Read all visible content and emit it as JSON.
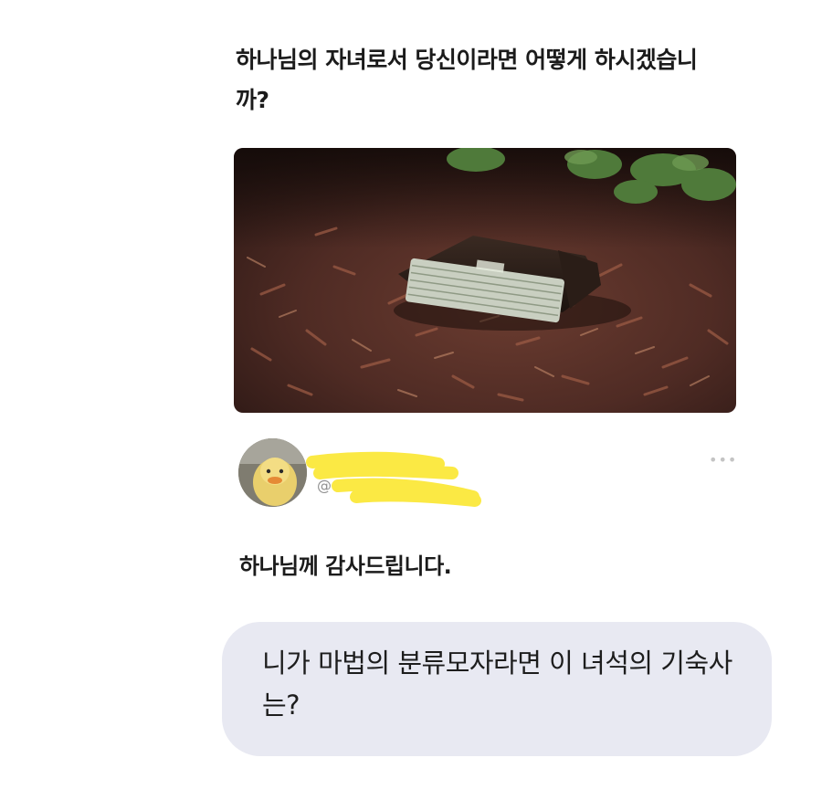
{
  "post": {
    "caption": "하나님의 자녀로서 당신이라면 어떻게 하시겠습니까?",
    "photo_icon": "wallet-with-cash-photo"
  },
  "reply": {
    "avatar_icon": "duckling-avatar",
    "handle_prefix": "@",
    "more_icon": "more-dots-icon",
    "more_glyph": "•••",
    "text": "하나님께 감사드립니다."
  },
  "message": {
    "text": "니가 마법의 분류모자라면 이 녀석의 기숙사는?"
  },
  "colors": {
    "background": "#ffffff",
    "bubble": "#e8e9f2",
    "redaction": "#fbe83a",
    "text": "#1b1b1b"
  }
}
